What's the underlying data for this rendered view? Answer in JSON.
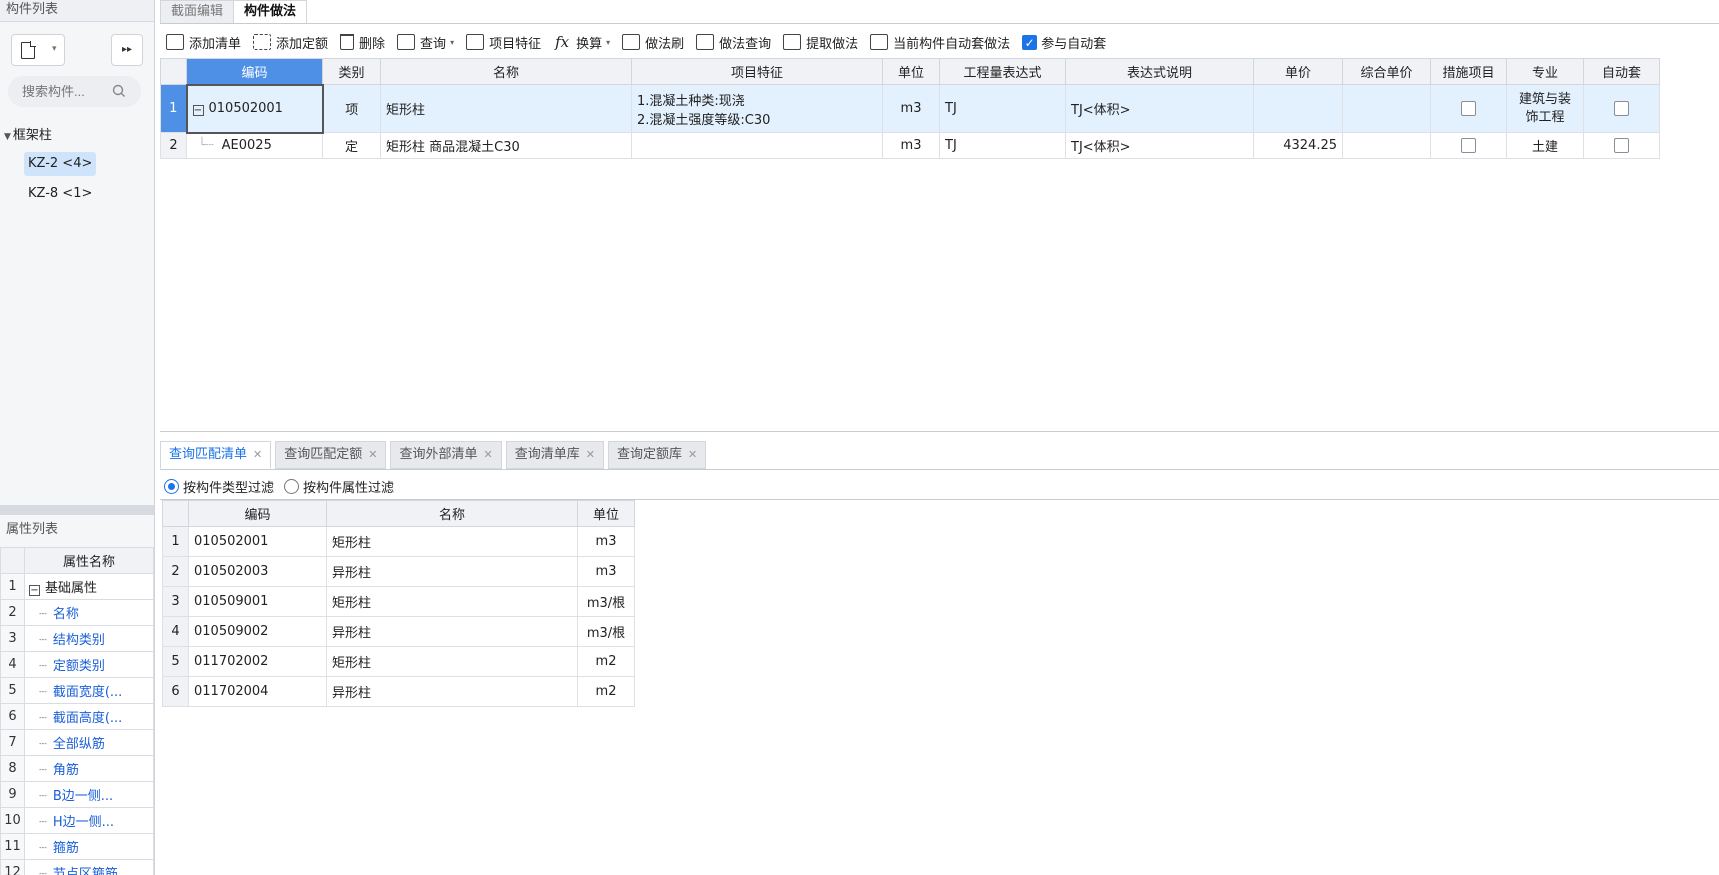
{
  "left_panel": {
    "title": "构件列表",
    "search_placeholder": "搜索构件...",
    "tree_root": "框架柱",
    "items": [
      {
        "label": "KZ-2 <4>"
      },
      {
        "label": "KZ-8 <1>"
      }
    ],
    "prop_title": "属性列表",
    "prop_header": "属性名称",
    "props": [
      {
        "n": "1",
        "label": "基础属性"
      },
      {
        "n": "2",
        "label": "名称"
      },
      {
        "n": "3",
        "label": "结构类别"
      },
      {
        "n": "4",
        "label": "定额类别"
      },
      {
        "n": "5",
        "label": "截面宽度(..."
      },
      {
        "n": "6",
        "label": "截面高度(..."
      },
      {
        "n": "7",
        "label": "全部纵筋"
      },
      {
        "n": "8",
        "label": "角筋"
      },
      {
        "n": "9",
        "label": "B边一侧..."
      },
      {
        "n": "10",
        "label": "H边一侧..."
      },
      {
        "n": "11",
        "label": "箍筋"
      },
      {
        "n": "12",
        "label": "节点区箍筋"
      }
    ]
  },
  "tabs": {
    "section_edit": "截面编辑",
    "component_method": "构件做法"
  },
  "toolbar": {
    "add_list": "添加清单",
    "add_quota": "添加定额",
    "delete": "删除",
    "query": "查询",
    "features": "项目特征",
    "convert": "换算",
    "brush": "做法刷",
    "method_query": "做法查询",
    "extract": "提取做法",
    "auto_current": "当前构件自动套做法",
    "auto_join": "参与自动套"
  },
  "main_table": {
    "headers": [
      "编码",
      "类别",
      "名称",
      "项目特征",
      "单位",
      "工程量表达式",
      "表达式说明",
      "单价",
      "综合单价",
      "措施项目",
      "专业",
      "自动套"
    ],
    "rows": [
      {
        "n": "1",
        "code": "010502001",
        "type": "项",
        "name": "矩形柱",
        "feat1": "1.混凝土种类:现浇",
        "feat2": "2.混凝土强度等级:C30",
        "unit": "m3",
        "expr": "TJ",
        "expr_desc": "TJ<体积>",
        "price": "",
        "total": "",
        "major1": "建筑与装",
        "major2": "饰工程"
      },
      {
        "n": "2",
        "code": "AE0025",
        "type": "定",
        "name": "矩形柱 商品混凝土C30",
        "unit": "m3",
        "expr": "TJ",
        "expr_desc": "TJ<体积>",
        "price": "4324.25",
        "total": "",
        "major": "土建"
      }
    ]
  },
  "bottom_tabs": [
    "查询匹配清单",
    "查询匹配定额",
    "查询外部清单",
    "查询清单库",
    "查询定额库"
  ],
  "filters": {
    "by_type": "按构件类型过滤",
    "by_attr": "按构件属性过滤"
  },
  "query_table": {
    "headers": [
      "编码",
      "名称",
      "单位"
    ],
    "rows": [
      {
        "n": "1",
        "code": "010502001",
        "name": "矩形柱",
        "unit": "m3"
      },
      {
        "n": "2",
        "code": "010502003",
        "name": "异形柱",
        "unit": "m3"
      },
      {
        "n": "3",
        "code": "010509001",
        "name": "矩形柱",
        "unit": "m3/根"
      },
      {
        "n": "4",
        "code": "010509002",
        "name": "异形柱",
        "unit": "m3/根"
      },
      {
        "n": "5",
        "code": "011702002",
        "name": "矩形柱",
        "unit": "m2"
      },
      {
        "n": "6",
        "code": "011702004",
        "name": "异形柱",
        "unit": "m2"
      }
    ]
  }
}
